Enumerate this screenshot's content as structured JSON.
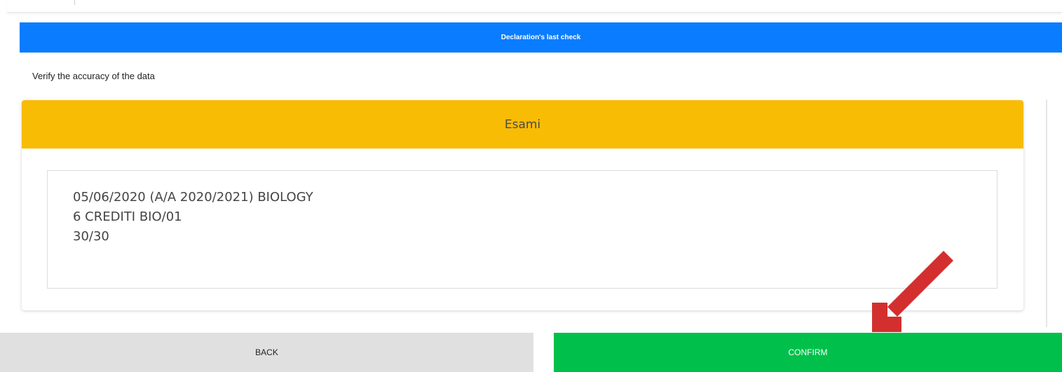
{
  "header": {
    "title": "Declaration's last check"
  },
  "subtitle": "Verify the accuracy of the data",
  "exam_section": {
    "title": "Esami",
    "lines": [
      "05/06/2020 (A/A 2020/2021) BIOLOGY",
      "6 CREDITI BIO/01",
      "30/30"
    ]
  },
  "buttons": {
    "back": "BACK",
    "confirm": "CONFIRM"
  },
  "colors": {
    "header": "#0a7cff",
    "section_header": "#f8bc05",
    "confirm": "#00c04b",
    "back": "#e0e0e0",
    "arrow": "#d32f2f"
  },
  "icons": {
    "annotation": "red-arrow-icon"
  }
}
